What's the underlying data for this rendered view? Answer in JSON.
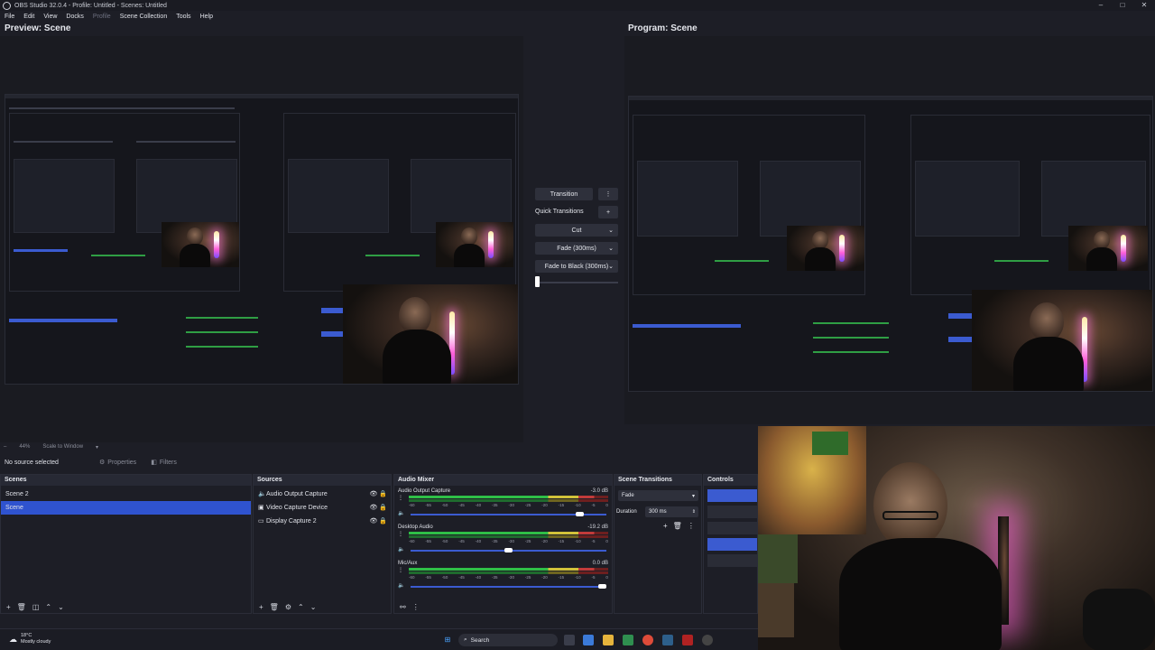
{
  "window": {
    "title": "OBS Studio 32.0.4 - Profile: Untitled - Scenes: Untitled",
    "controls": [
      "–",
      "□",
      "✕"
    ]
  },
  "menu": [
    "File",
    "Edit",
    "View",
    "Docks",
    "Profile",
    "Scene Collection",
    "Tools",
    "Help"
  ],
  "preview": {
    "title": "Preview: Scene"
  },
  "program": {
    "title": "Program: Scene"
  },
  "transition": {
    "button": "Transition",
    "quick_label": "Quick Transitions",
    "buttons": [
      "Cut",
      "Fade (300ms)",
      "Fade to Black (300ms)"
    ]
  },
  "zoom": {
    "percent": "44%",
    "mode": "Scale to Window"
  },
  "context": {
    "no_source": "No source selected",
    "properties": "Properties",
    "filters": "Filters"
  },
  "scenes": {
    "title": "Scenes",
    "items": [
      "Scene 2",
      "Scene"
    ],
    "selected_index": 1
  },
  "sources": {
    "title": "Sources",
    "items": [
      {
        "name": "Audio Output Capture",
        "icon": "speaker-icon"
      },
      {
        "name": "Video Capture Device",
        "icon": "camera-icon"
      },
      {
        "name": "Display Capture 2",
        "icon": "monitor-icon"
      }
    ]
  },
  "mixer": {
    "title": "Audio Mixer",
    "ticks": [
      "-60",
      "-55",
      "-50",
      "-45",
      "-40",
      "-35",
      "-30",
      "-25",
      "-20",
      "-15",
      "-10",
      "-5",
      "0"
    ],
    "channels": [
      {
        "name": "Audio Output Capture",
        "db": "-3.0 dB",
        "volume": 0.88
      },
      {
        "name": "Desktop Audio",
        "db": "-19.2 dB",
        "volume": 0.5
      },
      {
        "name": "Mic/Aux",
        "db": "0.0 dB",
        "volume": 1.0
      }
    ]
  },
  "scene_transitions": {
    "title": "Scene Transitions",
    "selected": "Fade",
    "duration_label": "Duration",
    "duration_value": "300 ms"
  },
  "controls": {
    "title": "Controls"
  },
  "taskbar": {
    "weather_temp": "18°C",
    "weather_desc": "Mostly cloudy",
    "search": "Search"
  }
}
